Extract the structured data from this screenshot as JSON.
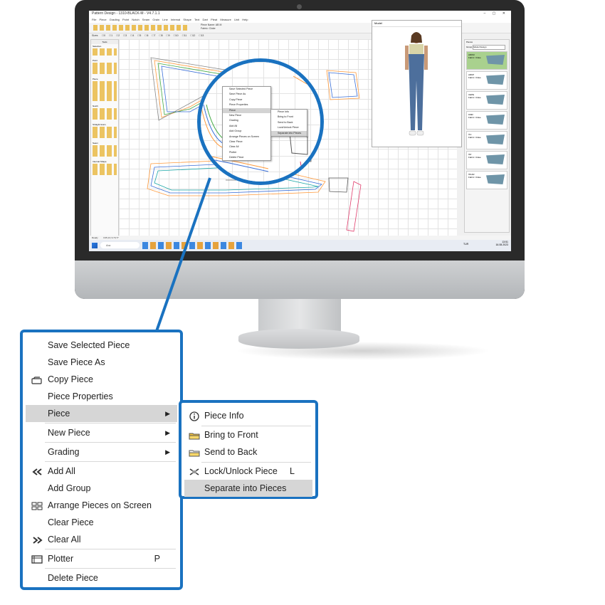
{
  "app": {
    "window_title": "Pattern Design - 1310-BLACK-M - V4.7.1.1",
    "menu": [
      "File",
      "Piece",
      "Grading",
      "Point",
      "Notch",
      "Seam",
      "Grain Line",
      "Internal Shape",
      "Text",
      "Dart",
      "Pleat",
      "Measure",
      "Unit",
      "Help"
    ],
    "piece_name_label": "Piece Name: AB M",
    "fabric_label": "Fabric: Cloke",
    "size_label": "Sizes",
    "sizes": [
      "0",
      "1",
      "2",
      "3",
      "4",
      "5",
      "6",
      "7",
      "8",
      "9",
      "10",
      "11",
      "12",
      "13"
    ],
    "tools_title": "Tools",
    "tool_sections": [
      "Selection",
      "Point",
      "Piece",
      "Notch",
      "Straight Grain",
      "Seam",
      "Internal Shape"
    ],
    "model_title": "Model",
    "pieces_title": "Pieces",
    "group_label": "Group",
    "group_value": "Model Design",
    "piece_cards": [
      {
        "name": "ARKM",
        "fabric": "Fabric: Cloke"
      },
      {
        "name": "ARKP",
        "fabric": "Fabric: Cloke"
      },
      {
        "name": "CEPE",
        "fabric": "Fabric: Cloke"
      },
      {
        "name": "KMR",
        "fabric": "Fabric: Cloke"
      },
      {
        "name": "ÖC",
        "fabric": "Fabric: Cloke"
      },
      {
        "name": "ÖP",
        "fabric": "Fabric: Cloke"
      },
      {
        "name": "ÖKAR",
        "fabric": "Fabric: Cloke"
      }
    ],
    "status": "Ready",
    "coords": "3.05,13; 9.70,77",
    "search_placeholder": "Ara",
    "tray_lang": "TUR",
    "clock_time": "13:51",
    "clock_date": "16.08.2023"
  },
  "context_menu": {
    "items": [
      {
        "label": "Save Selected Piece",
        "icon": "",
        "has_arrow": false,
        "shortcut": "",
        "highlighted": false
      },
      {
        "label": "Save Piece As",
        "icon": "",
        "has_arrow": false,
        "shortcut": "",
        "highlighted": false
      },
      {
        "label": "Copy Piece",
        "icon": "copy",
        "has_arrow": false,
        "shortcut": "",
        "highlighted": false
      },
      {
        "label": "Piece Properties",
        "icon": "",
        "has_arrow": false,
        "shortcut": "",
        "highlighted": false
      },
      {
        "label": "Piece",
        "icon": "",
        "has_arrow": true,
        "shortcut": "",
        "highlighted": true
      },
      {
        "label": "New Piece",
        "icon": "",
        "has_arrow": true,
        "shortcut": "",
        "highlighted": false
      },
      {
        "label": "Grading",
        "icon": "",
        "has_arrow": true,
        "shortcut": "",
        "highlighted": false
      },
      {
        "label": "Add All",
        "icon": "double-left",
        "has_arrow": false,
        "shortcut": "",
        "highlighted": false
      },
      {
        "label": "Add Group",
        "icon": "",
        "has_arrow": false,
        "shortcut": "",
        "highlighted": false
      },
      {
        "label": "Arrange Pieces on Screen",
        "icon": "arrange",
        "has_arrow": false,
        "shortcut": "",
        "highlighted": false
      },
      {
        "label": "Clear Piece",
        "icon": "",
        "has_arrow": false,
        "shortcut": "",
        "highlighted": false
      },
      {
        "label": "Clear All",
        "icon": "double-right",
        "has_arrow": false,
        "shortcut": "",
        "highlighted": false
      },
      {
        "label": "Plotter",
        "icon": "plotter",
        "has_arrow": false,
        "shortcut": "P",
        "highlighted": false
      },
      {
        "label": "Delete Piece",
        "icon": "",
        "has_arrow": false,
        "shortcut": "",
        "highlighted": false
      }
    ]
  },
  "submenu": {
    "items": [
      {
        "label": "Piece Info",
        "icon": "info",
        "shortcut": "",
        "highlighted": false
      },
      {
        "label": "Bring to Front",
        "icon": "folder-front",
        "shortcut": "",
        "highlighted": false
      },
      {
        "label": "Send to Back",
        "icon": "folder-back",
        "shortcut": "",
        "highlighted": false
      },
      {
        "label": "Lock/Unlock Piece",
        "icon": "lock",
        "shortcut": "L",
        "highlighted": false
      },
      {
        "label": "Separate into Pieces",
        "icon": "",
        "shortcut": "",
        "highlighted": true
      }
    ]
  },
  "colors": {
    "accent_blue": "#1a72c0",
    "highlight_gray": "#d6d6d6",
    "piece_fill": "#6f95a8"
  }
}
